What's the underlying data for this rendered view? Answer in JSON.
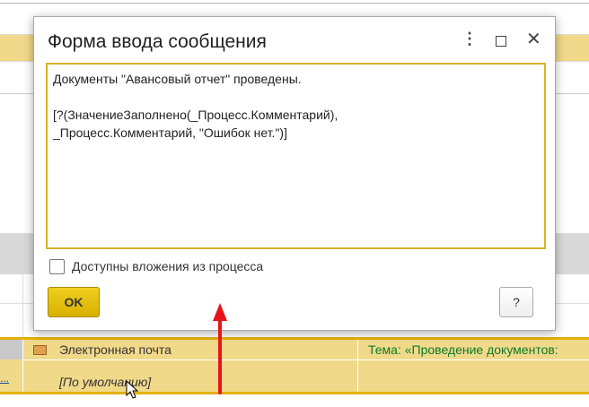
{
  "dialog": {
    "title": "Форма ввода сообщения",
    "menu_icon": "more-vertical-icon",
    "maximize_icon": "maximize-icon",
    "close_icon": "close-icon",
    "message_text": "Документы \"Авансовый отчет\" проведены.\n\n[?(ЗначениеЗаполнено(_Процесс.Комментарий),\n_Процесс.Комментарий, \"Ошибок нет.\")]",
    "checkbox_label": "Доступны вложения из процесса",
    "checkbox_checked": false,
    "ok_label": "OK",
    "help_label": "?"
  },
  "background_table": {
    "rows": [
      {
        "channel": "Электронная почта",
        "subject": "Тема: «Проведение документов:"
      },
      {
        "channel": "[По умолчанию]",
        "subject": ""
      }
    ],
    "row_link": "..."
  },
  "colors": {
    "accent": "#d7b323",
    "selected_row": "#f1d98a",
    "arrow": "#e8141c"
  }
}
